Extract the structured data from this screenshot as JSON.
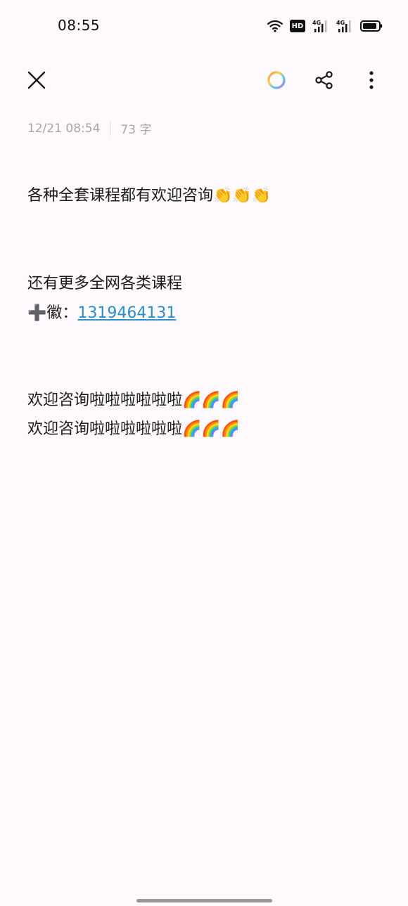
{
  "status_bar": {
    "time": "08:55",
    "icons": [
      "wifi-icon",
      "hd-icon",
      "signal-4g-icon",
      "signal-4g-icon",
      "battery-icon"
    ],
    "hd_label": "HD",
    "network_label": "4G"
  },
  "toolbar": {
    "icons": [
      "close-icon",
      "color-ring-icon",
      "share-icon",
      "more-vertical-icon"
    ]
  },
  "note": {
    "date": "12/21 08:54",
    "char_count": "73 字",
    "line1": "各种全套课程都有欢迎咨询👏👏👏",
    "line2": "还有更多全网各类课程",
    "line3_prefix": "➕徽：",
    "line3_link": "1319464131",
    "line4": "欢迎咨询啦啦啦啦啦啦🌈🌈🌈",
    "line5": "欢迎咨询啦啦啦啦啦啦🌈🌈🌈"
  },
  "colors": {
    "background": "#fdf9fc",
    "link": "#2c8ec4",
    "meta_text": "#a8a4a8"
  }
}
